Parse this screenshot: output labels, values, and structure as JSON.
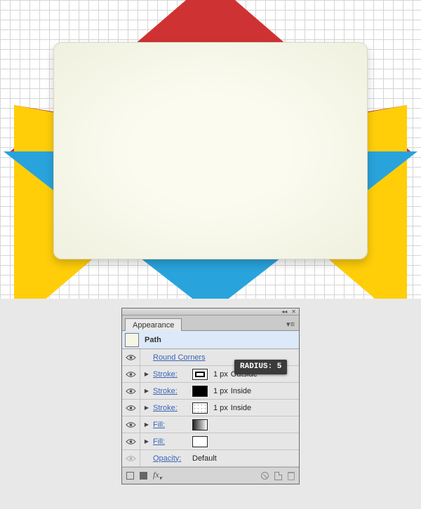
{
  "panel": {
    "title": "Appearance",
    "selection_label": "Path",
    "rows": {
      "round_corners": {
        "label": "Round Corners"
      },
      "stroke1": {
        "label": "Stroke:",
        "size": "1 px",
        "align": "Outside"
      },
      "stroke2": {
        "label": "Stroke:",
        "size": "1 px",
        "align": "Inside"
      },
      "stroke3": {
        "label": "Stroke:",
        "size": "1 px",
        "align": "Inside"
      },
      "fill1": {
        "label": "Fill:"
      },
      "fill2": {
        "label": "Fill:"
      },
      "opacity": {
        "label": "Opacity:",
        "value": "Default"
      }
    },
    "tooltip": "RADIUS: 5"
  }
}
